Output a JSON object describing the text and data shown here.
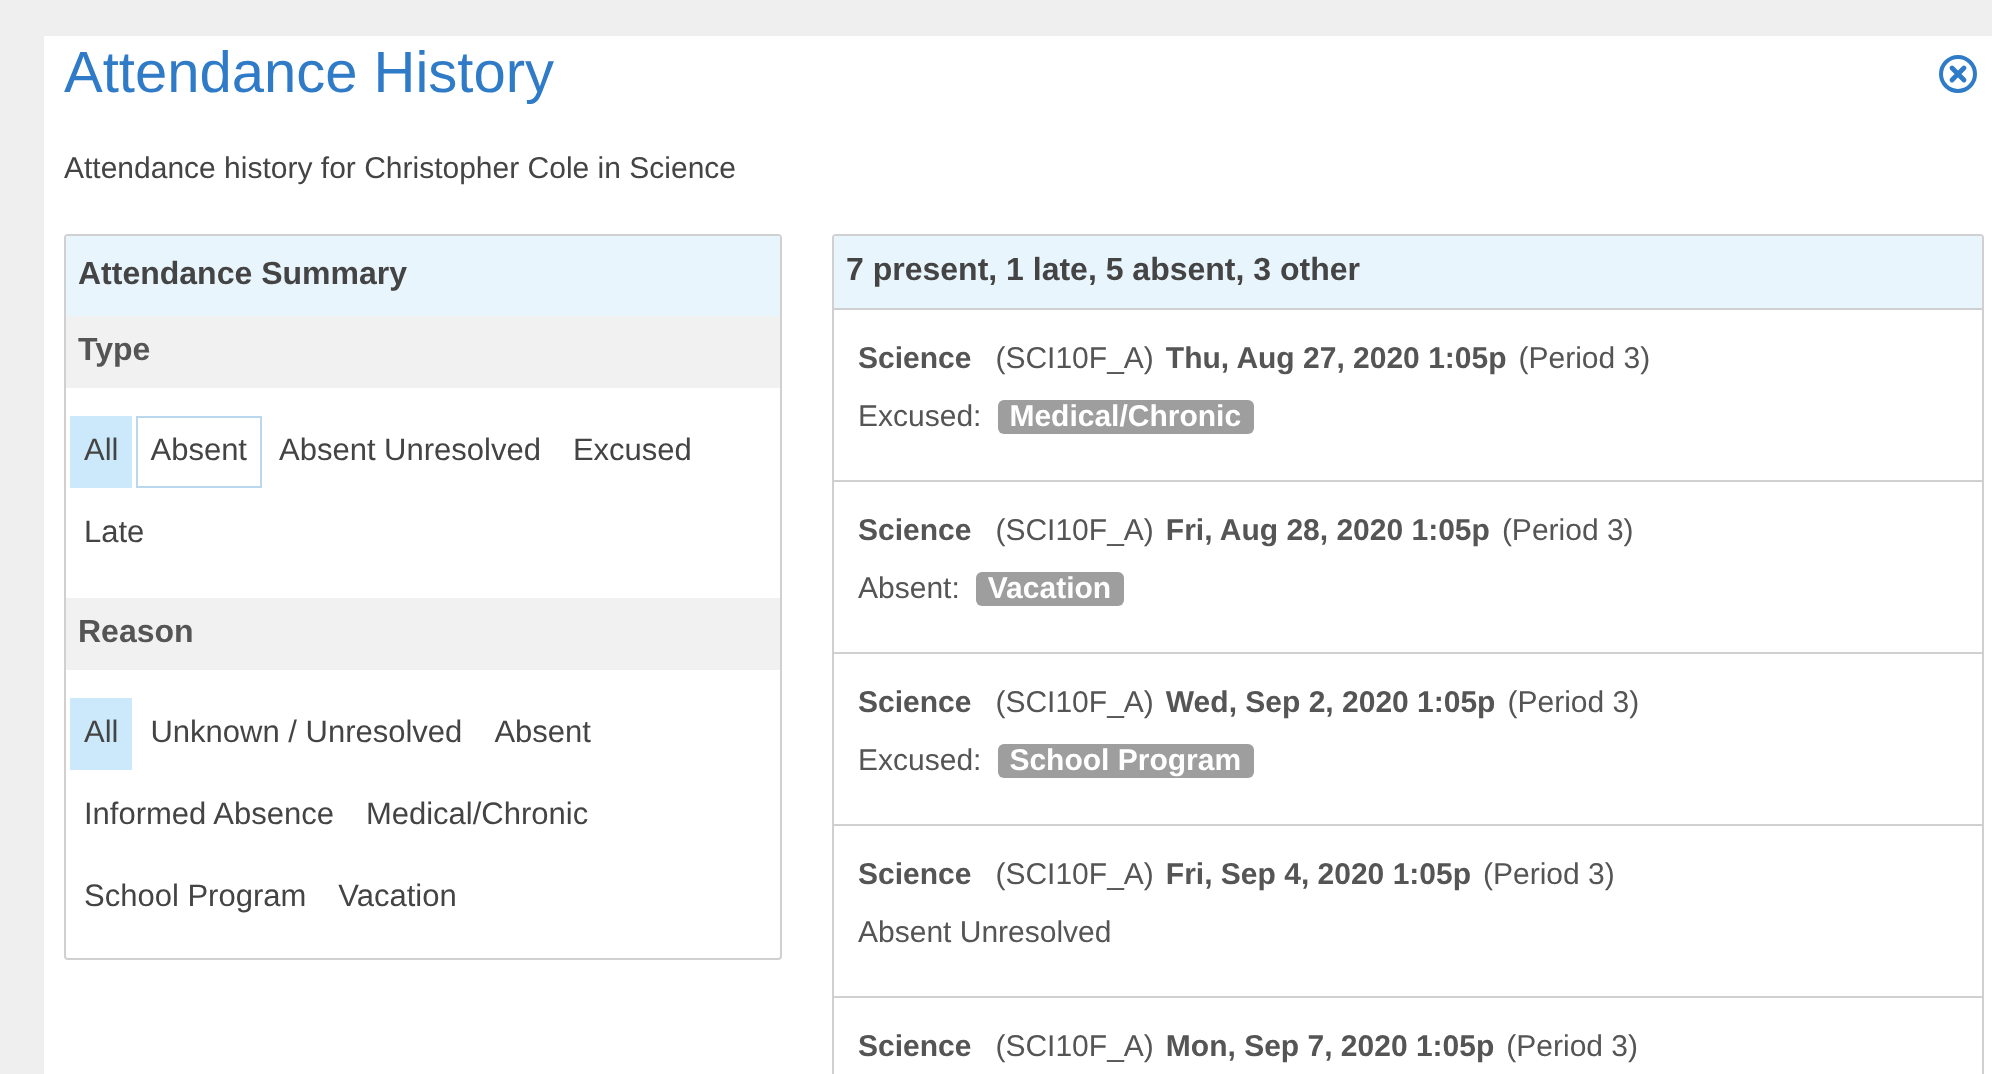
{
  "dialog": {
    "title": "Attendance History",
    "subtitle": "Attendance history for Christopher Cole in Science"
  },
  "summary": {
    "title": "Attendance Summary",
    "groups": [
      {
        "heading": "Type",
        "filters": [
          {
            "label": "All",
            "selected": true,
            "focused": false
          },
          {
            "label": "Absent",
            "selected": false,
            "focused": true
          },
          {
            "label": "Absent Unresolved",
            "selected": false,
            "focused": false
          },
          {
            "label": "Excused",
            "selected": false,
            "focused": false
          },
          {
            "label": "Late",
            "selected": false,
            "focused": false
          }
        ]
      },
      {
        "heading": "Reason",
        "filters": [
          {
            "label": "All",
            "selected": true,
            "focused": false
          },
          {
            "label": "Unknown / Unresolved",
            "selected": false,
            "focused": false
          },
          {
            "label": "Absent",
            "selected": false,
            "focused": false
          },
          {
            "label": "Informed Absence",
            "selected": false,
            "focused": false
          },
          {
            "label": "Medical/Chronic",
            "selected": false,
            "focused": false
          },
          {
            "label": "School Program",
            "selected": false,
            "focused": false
          },
          {
            "label": "Vacation",
            "selected": false,
            "focused": false
          }
        ]
      }
    ]
  },
  "history": {
    "counts": "7 present, 1 late, 5 absent, 3 other",
    "records": [
      {
        "course": "Science",
        "section": "(SCI10F_A)",
        "datetime": "Thu, Aug 27, 2020 1:05p",
        "period": "(Period 3)",
        "status": "Excused:",
        "reason": "Medical/Chronic"
      },
      {
        "course": "Science",
        "section": "(SCI10F_A)",
        "datetime": "Fri, Aug 28, 2020 1:05p",
        "period": "(Period 3)",
        "status": "Absent:",
        "reason": "Vacation"
      },
      {
        "course": "Science",
        "section": "(SCI10F_A)",
        "datetime": "Wed, Sep 2, 2020 1:05p",
        "period": "(Period 3)",
        "status": "Excused:",
        "reason": "School Program"
      },
      {
        "course": "Science",
        "section": "(SCI10F_A)",
        "datetime": "Fri, Sep 4, 2020 1:05p",
        "period": "(Period 3)",
        "status": "Absent Unresolved"
      },
      {
        "course": "Science",
        "section": "(SCI10F_A)",
        "datetime": "Mon, Sep 7, 2020 1:05p",
        "period": "(Period 3)"
      }
    ]
  }
}
